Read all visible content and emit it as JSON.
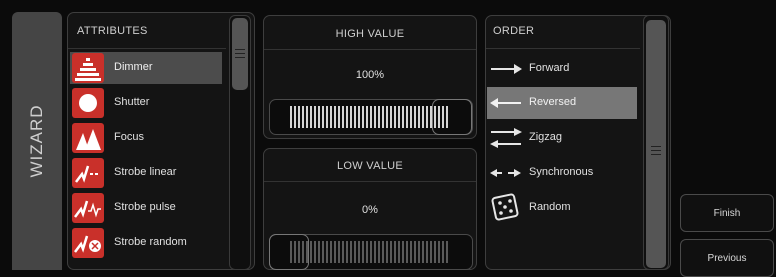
{
  "wizard_tab": "WIZARD",
  "attributes": {
    "header": "ATTRIBUTES",
    "items": [
      {
        "label": "Dimmer",
        "icon": "dimmer-icon",
        "selected": true
      },
      {
        "label": "Shutter",
        "icon": "shutter-icon",
        "selected": false
      },
      {
        "label": "Focus",
        "icon": "focus-icon",
        "selected": false
      },
      {
        "label": "Strobe linear",
        "icon": "strobe-linear-icon",
        "selected": false
      },
      {
        "label": "Strobe pulse",
        "icon": "strobe-pulse-icon",
        "selected": false
      },
      {
        "label": "Strobe random",
        "icon": "strobe-random-icon",
        "selected": false
      }
    ]
  },
  "high_value": {
    "header": "HIGH VALUE",
    "value": "100%",
    "level": 1.0
  },
  "low_value": {
    "header": "LOW VALUE",
    "value": "0%",
    "level": 0.0
  },
  "order": {
    "header": "ORDER",
    "items": [
      {
        "label": "Forward",
        "icon": "arrow-right-icon",
        "selected": false
      },
      {
        "label": "Reversed",
        "icon": "arrow-left-icon",
        "selected": true
      },
      {
        "label": "Zigzag",
        "icon": "zigzag-arrows-icon",
        "selected": false
      },
      {
        "label": "Synchronous",
        "icon": "double-arrow-icon",
        "selected": false
      },
      {
        "label": "Random",
        "icon": "dice-icon",
        "selected": false
      }
    ]
  },
  "buttons": {
    "finish": "Finish",
    "previous": "Previous"
  },
  "colors": {
    "accent_red": "#c9302a",
    "selected_row": "#4c4c4c",
    "selected_order": "#777777"
  }
}
